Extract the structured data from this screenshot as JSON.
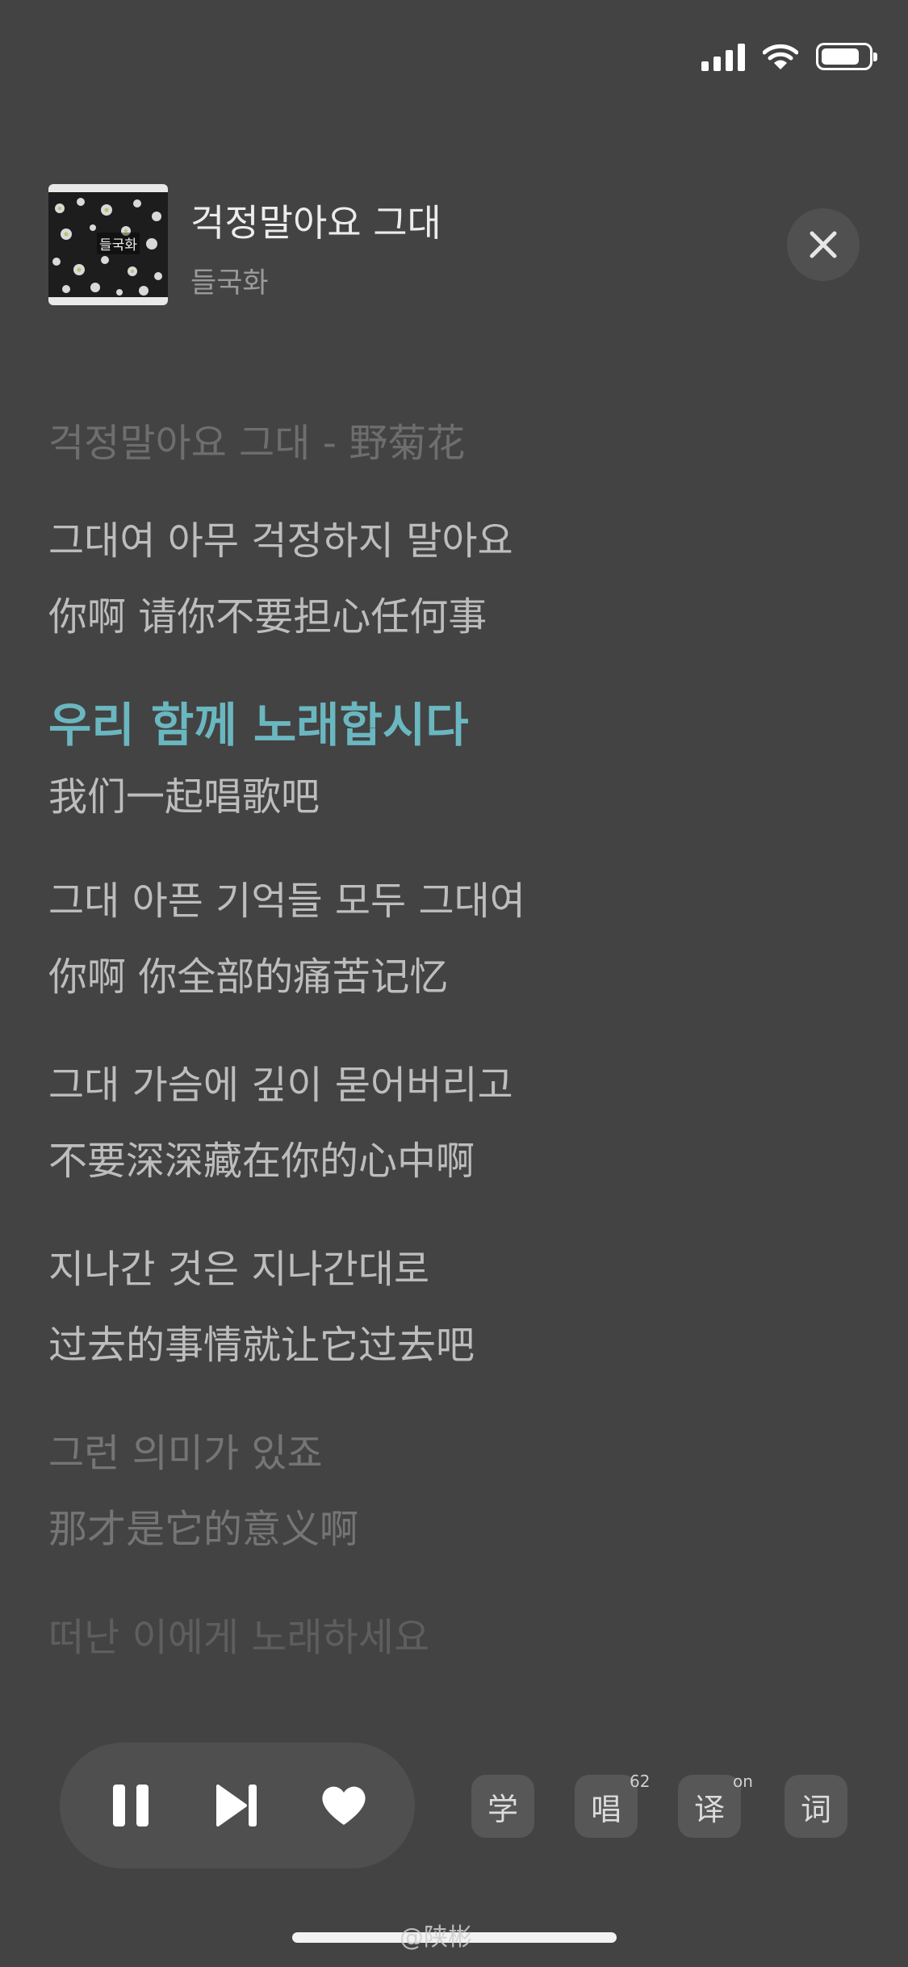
{
  "header": {
    "title": "걱정말아요 그대",
    "artist": "들국화",
    "cover_label": "들국화"
  },
  "lyrics": {
    "heading": "걱정말아요 그대 - 野菊花",
    "lines": [
      {
        "ko": "그대여 아무 걱정하지 말아요",
        "zh": "你啊 请你不要担心任何事"
      },
      {
        "ko": "우리 함께 노래합시다",
        "zh": "我们一起唱歌吧"
      },
      {
        "ko": "그대 아픈 기억들 모두 그대여",
        "zh": "你啊 你全部的痛苦记忆"
      },
      {
        "ko": "그대 가슴에 깊이 묻어버리고",
        "zh": "不要深深藏在你的心中啊"
      },
      {
        "ko": "지나간 것은 지나간대로",
        "zh": "过去的事情就让它过去吧"
      },
      {
        "ko": "그런 의미가 있죠",
        "zh": "那才是它的意义啊"
      },
      {
        "ko": "떠난 이에게 노래하세요"
      }
    ]
  },
  "options": {
    "learn": "学",
    "sing": "唱",
    "sing_badge": "62",
    "translate": "译",
    "translate_badge": "on",
    "lyrics": "词"
  },
  "watermark": "@陕彬",
  "colors": {
    "background": "#434343",
    "highlight": "#6ab7c0"
  },
  "icons": [
    "signal-icon",
    "wifi-icon",
    "battery-icon",
    "close-icon",
    "pause-icon",
    "next-icon",
    "heart-icon"
  ]
}
